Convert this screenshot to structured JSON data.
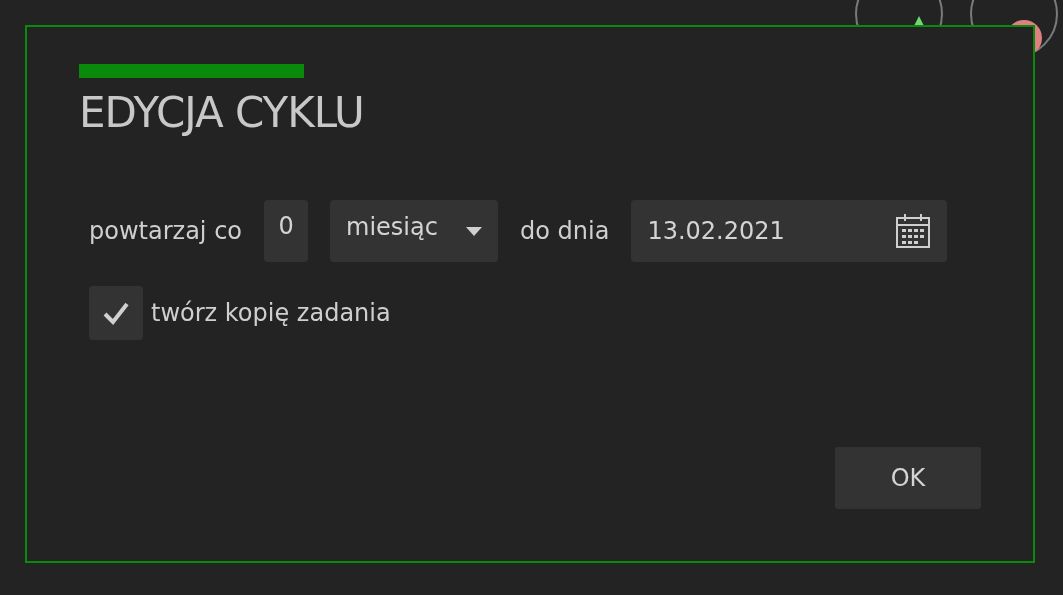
{
  "dialog": {
    "title": "EDYCJA CYKLU"
  },
  "repeat": {
    "label": "powtarzaj co",
    "count": "0",
    "unit": "miesiąc",
    "until_label": "do dnia",
    "date": "13.02.2021"
  },
  "copy_task": {
    "label": "twórz kopię zadania",
    "checked": true
  },
  "buttons": [
    "OK"
  ]
}
